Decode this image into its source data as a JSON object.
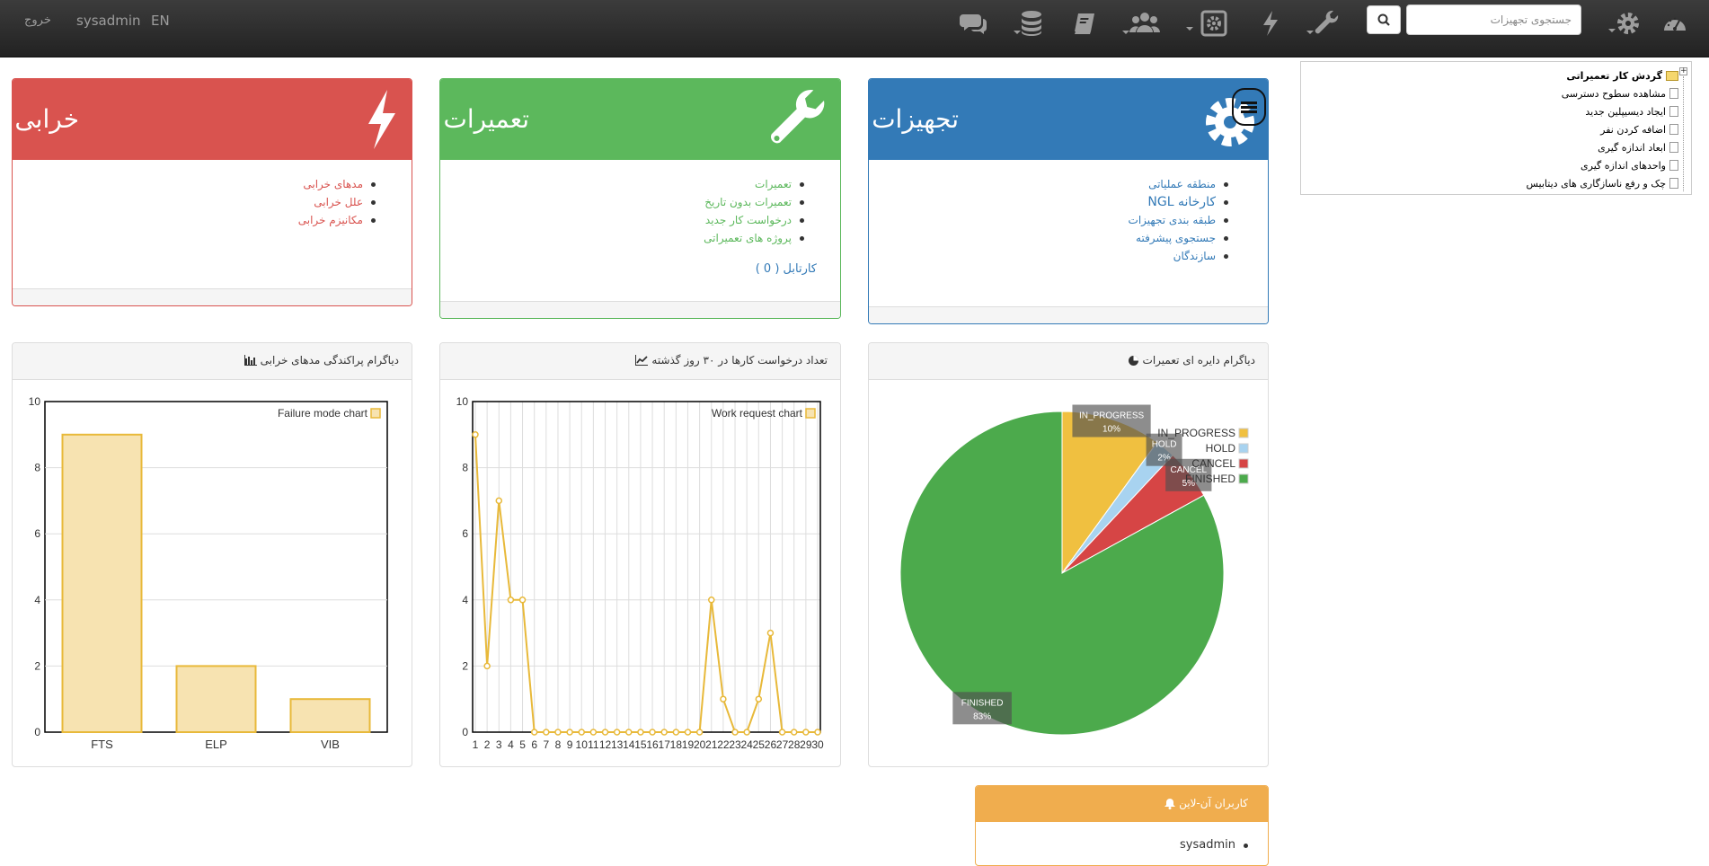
{
  "navbar": {
    "language": "EN",
    "user": "sysadmin",
    "logout": "خروج",
    "search_placeholder": "جستجوی تجهیزات",
    "icons": [
      "chat-icon",
      "database-icon",
      "book-icon",
      "users-icon",
      "settings-box-icon",
      "bolt-icon",
      "wrench-icon",
      "search-icon",
      "gear-icon",
      "dashboard-icon"
    ]
  },
  "panels": {
    "failure": {
      "title": "خرابی",
      "color": "#d9534f",
      "links": [
        "مدهای خرابی",
        "علل خرابی",
        "مکانیزم خرابی"
      ]
    },
    "repairs": {
      "title": "تعمیرات",
      "color": "#5cb85c",
      "links": [
        "تعمیرات",
        "تعمیرات بدون تاریخ",
        "درخواست کار جدید",
        "پروژه های تعمیراتی"
      ],
      "kartabl": "کارتابل ( 0 )"
    },
    "equipment": {
      "title": "تجهیزات",
      "color": "#337ab7",
      "links": [
        "منطقه عملیاتی",
        "کارخانه NGL",
        "طبقه بندی تجهیزات",
        "جستجوی پیشرفته",
        "سازندگان"
      ]
    }
  },
  "tree": {
    "root": "گردش کار تعمیراتی",
    "items": [
      "مشاهده سطوح دسترسی",
      "ایجاد دیسیپلین جدید",
      "اضافه کردن نفر",
      "ابعاد اندازه گیری",
      "واحدهای اندازه گیری",
      "چک و رفع ناسازگاری های دیتابیس"
    ]
  },
  "online": {
    "title": "کاربران آن-لاین",
    "users": [
      "sysadmin"
    ]
  },
  "chart_data": [
    {
      "type": "bar",
      "title": "دیاگرام پراکندگی مدهای خرابی",
      "legend": "Failure mode chart",
      "categories": [
        "FTS",
        "ELP",
        "VIB"
      ],
      "values": [
        9,
        2,
        1
      ],
      "ylim": [
        0,
        10
      ],
      "yticks": [
        0,
        2,
        4,
        6,
        8,
        10
      ],
      "color": "#e8b93a",
      "fill": "#f7e3b1",
      "grid": true,
      "legend_position": "top-right"
    },
    {
      "type": "line",
      "title": "تعداد درخواست کارها در ۳۰ روز گذشته",
      "legend": "Work request chart",
      "x": [
        1,
        2,
        3,
        4,
        5,
        6,
        7,
        8,
        9,
        10,
        11,
        12,
        13,
        14,
        15,
        16,
        17,
        18,
        19,
        20,
        21,
        22,
        23,
        24,
        25,
        26,
        27,
        28,
        29,
        30
      ],
      "values": [
        9,
        2,
        7,
        4,
        4,
        0,
        0,
        0,
        0,
        0,
        0,
        0,
        0,
        0,
        0,
        0,
        0,
        0,
        0,
        0,
        4,
        1,
        0,
        0,
        1,
        3,
        0,
        0,
        0,
        0
      ],
      "ylim": [
        0,
        10
      ],
      "yticks": [
        0,
        2,
        4,
        6,
        8,
        10
      ],
      "color": "#e8b93a",
      "grid": true,
      "legend_position": "top-right"
    },
    {
      "type": "pie",
      "title": "دیاگرام دایره ای تعمیرات",
      "slices": [
        {
          "name": "IN_PROGRESS",
          "percent": 10,
          "color": "#f0c040"
        },
        {
          "name": "HOLD",
          "percent": 2,
          "color": "#a8d3f0"
        },
        {
          "name": "CANCEL",
          "percent": 5,
          "color": "#d64545"
        },
        {
          "name": "FINISHED",
          "percent": 83,
          "color": "#4caa4c"
        }
      ],
      "legend_position": "top-right"
    }
  ]
}
